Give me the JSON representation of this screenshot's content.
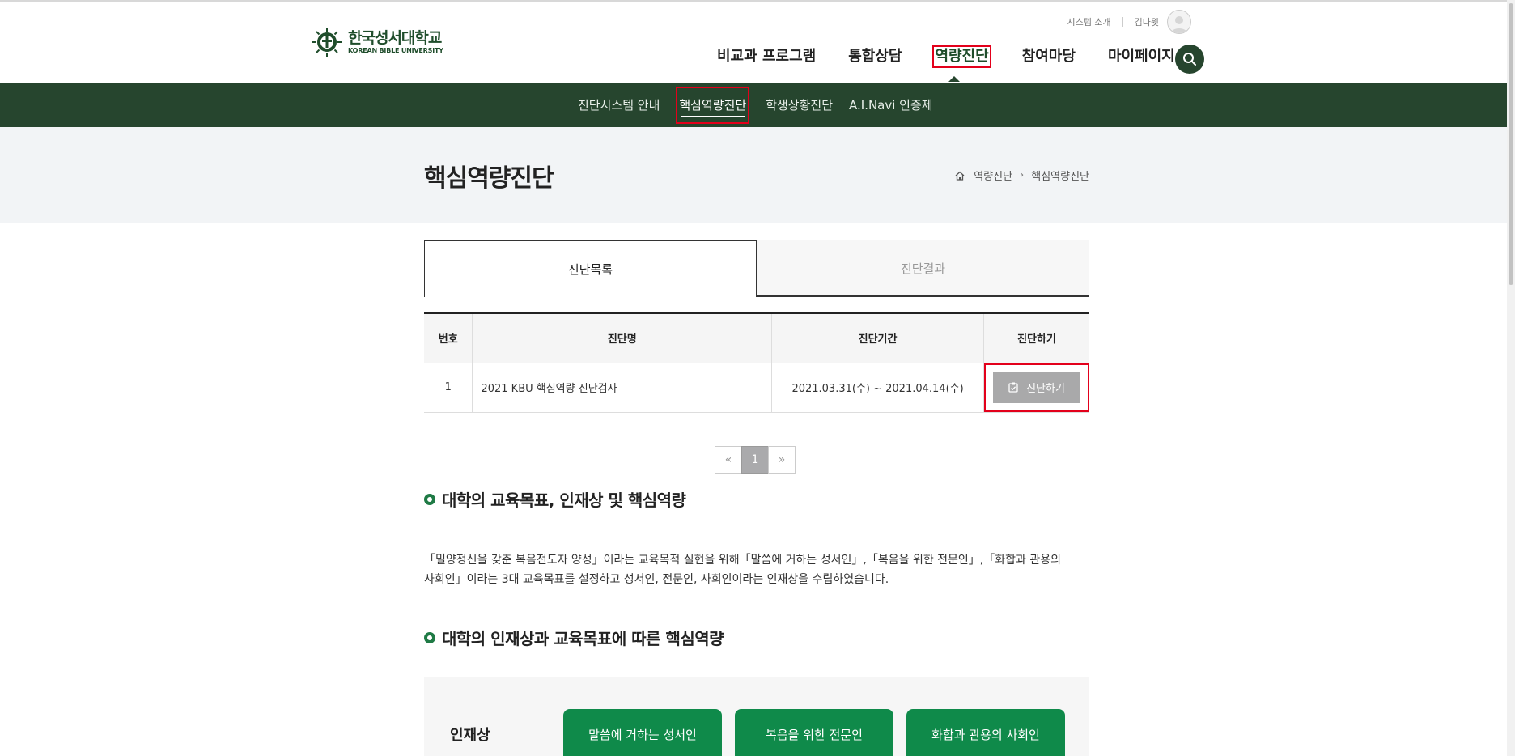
{
  "header": {
    "logo": {
      "name_ko": "한국성서대학교",
      "name_en": "KOREAN BIBLE UNIVERSITY"
    },
    "util": {
      "system_intro": "시스템 소개",
      "user_name": "김다윗"
    },
    "gnb": [
      {
        "label": "비교과 프로그램"
      },
      {
        "label": "통합상담"
      },
      {
        "label": "역량진단",
        "active": true
      },
      {
        "label": "참여마당"
      },
      {
        "label": "마이페이지"
      }
    ]
  },
  "subnav": [
    {
      "label": "진단시스템 안내"
    },
    {
      "label": "핵심역량진단",
      "active": true
    },
    {
      "label": "학생상황진단"
    },
    {
      "label": "A.I.Navi 인증제"
    }
  ],
  "page": {
    "title": "핵심역량진단",
    "breadcrumb": [
      "역량진단",
      "핵심역량진단"
    ]
  },
  "tabs": [
    {
      "label": "진단목록",
      "active": true
    },
    {
      "label": "진단결과"
    }
  ],
  "table": {
    "headers": [
      "번호",
      "진단명",
      "진단기간",
      "진단하기"
    ],
    "rows": [
      {
        "no": "1",
        "name": "2021 KBU 핵심역량 진단검사",
        "period": "2021.03.31(수) ~ 2021.04.14(수)",
        "action": "진단하기"
      }
    ]
  },
  "pagination": {
    "prev": "«",
    "current": "1",
    "next": "»"
  },
  "section1": {
    "title": "대학의 교육목표, 인재상 및 핵심역량",
    "line1": "「밀양정신을 갖춘 복음전도자 양성」이라는 교육목적 실현을 위해「말씀에 거하는 성서인」,「복음을 위한 전문인」,「화합과 관용의",
    "line2": "사회인」이라는 3대 교육목표를 설정하고 성서인, 전문인, 사회인이라는 인재상을 수립하였습니다."
  },
  "section2": {
    "title": "대학의 인재상과 교육목표에 따른 핵심역량",
    "label": "인재상",
    "items": [
      "말씀에 거하는 성서인",
      "복음을 위한 전문인",
      "화합과 관용의 사회인"
    ]
  },
  "colors": {
    "primary_green": "#26452e",
    "accent_green": "#0f8a4a",
    "highlight_red": "#e3001b"
  }
}
